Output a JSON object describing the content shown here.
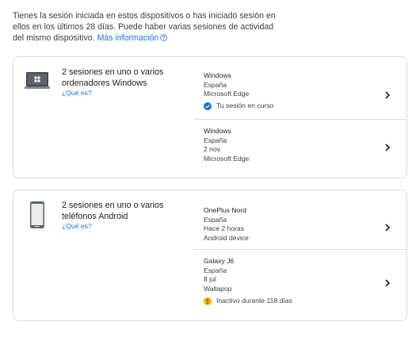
{
  "intro": {
    "text": "Tienes la sesión iniciada en estos dispositivos o has iniciado sesión en ellos en los últimos 28 días. Puede haber varias sesiones de actividad del mismo dispositivo.",
    "more_link": "Más información"
  },
  "groups": [
    {
      "summary": "2 sesiones en uno o varios ordenadores Windows",
      "whatis": "¿Qué es?",
      "device_icon": "laptop-windows-icon",
      "sessions": [
        {
          "name": "Windows",
          "lines": [
            "España",
            "Microsoft Edge"
          ],
          "status": "Tu sesión en curso",
          "status_icon": "check-circle-icon"
        },
        {
          "name": "Windows",
          "lines": [
            "España",
            "2 nov",
            "Microsoft Edge"
          ]
        }
      ]
    },
    {
      "summary": "2 sesiones en uno o varios teléfonos Android",
      "whatis": "¿Qué es?",
      "device_icon": "android-phone-icon",
      "sessions": [
        {
          "name": "OnePlus Nord",
          "lines": [
            "España",
            "Hace 2 horas",
            "Android device"
          ]
        },
        {
          "name": "Galaxy J6",
          "lines": [
            "España",
            "8 jul",
            "Wallapop"
          ],
          "status": "Inactivo durante 118 días",
          "status_icon": "warning-circle-icon"
        }
      ]
    }
  ],
  "colors": {
    "link": "#1a73e8",
    "check": "#1a73e8",
    "warning": "#f9ab00",
    "border": "#dadce0"
  }
}
